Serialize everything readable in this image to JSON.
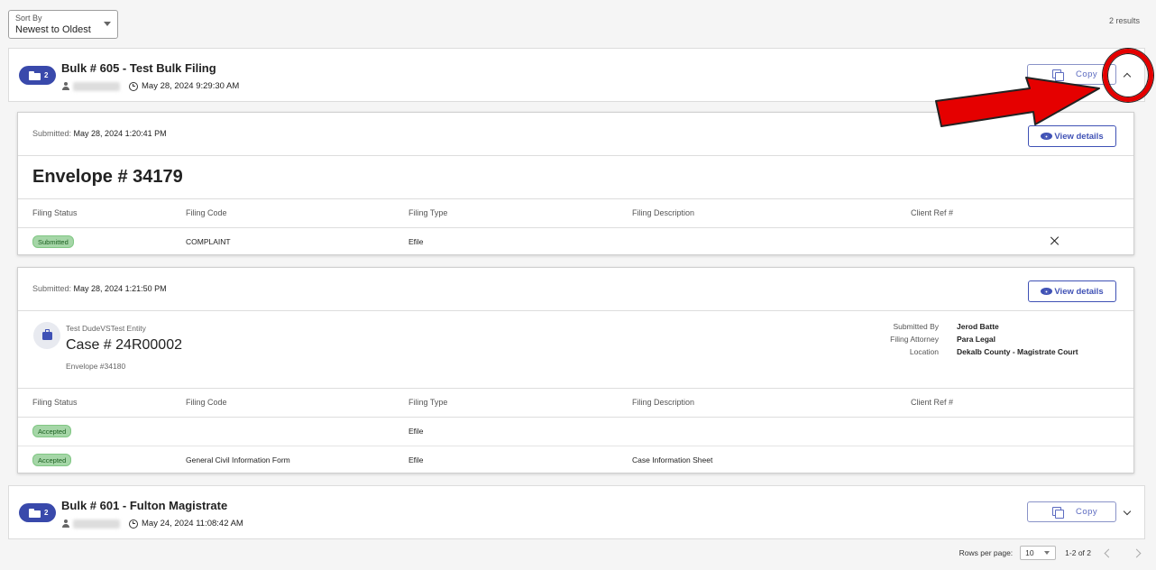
{
  "sort": {
    "label": "Sort By",
    "value": "Newest to Oldest"
  },
  "results_count": "2 results",
  "bulks": [
    {
      "folder_count": "2",
      "title": "Bulk # 605 - Test Bulk Filing",
      "datetime": "May 28, 2024 9:29:30 AM",
      "copy_label": "Copy",
      "expanded": true
    },
    {
      "folder_count": "2",
      "title": "Bulk # 601 - Fulton Magistrate",
      "datetime": "May 24, 2024 11:08:42 AM",
      "copy_label": "Copy",
      "expanded": false
    }
  ],
  "envelopes": [
    {
      "submitted_label": "Submitted:",
      "submitted_value": "May 28, 2024 1:20:41 PM",
      "view_details": "View details",
      "title": "Envelope # 34179",
      "columns": [
        "Filing Status",
        "Filing Code",
        "Filing Type",
        "Filing Description",
        "Client Ref #"
      ],
      "rows": [
        {
          "status": "Submitted",
          "code": "COMPLAINT",
          "type": "Efile",
          "description": "",
          "client_ref": ""
        }
      ]
    },
    {
      "submitted_label": "Submitted:",
      "submitted_value": "May 28, 2024 1:21:50 PM",
      "view_details": "View details",
      "case_parties": "Test DudeVSTest Entity",
      "case_number": "Case # 24R00002",
      "envelope_ref": "Envelope #34180",
      "info": [
        {
          "label": "Submitted By",
          "value": "Jerod Batte"
        },
        {
          "label": "Filing Attorney",
          "value": "Para Legal"
        },
        {
          "label": "Location",
          "value": "Dekalb County - Magistrate Court"
        }
      ],
      "columns": [
        "Filing Status",
        "Filing Code",
        "Filing Type",
        "Filing Description",
        "Client Ref #"
      ],
      "rows": [
        {
          "status": "Accepted",
          "code": "",
          "type": "Efile",
          "description": "",
          "client_ref": ""
        },
        {
          "status": "Accepted",
          "code": "General Civil Information Form",
          "type": "Efile",
          "description": "Case Information Sheet",
          "client_ref": ""
        }
      ]
    }
  ],
  "pagination": {
    "rows_per_page_label": "Rows per page:",
    "rows_per_page": "10",
    "range": "1-2 of 2"
  },
  "icons": {
    "sort_caret": "chevron-down-icon",
    "folder": "folder-icon",
    "person": "person-icon",
    "clock": "clock-icon",
    "copy": "copy-icon",
    "expand": "chevron-up-icon",
    "collapse": "chevron-down-icon",
    "eye": "eye-icon",
    "briefcase": "briefcase-icon",
    "remove": "close-icon"
  },
  "colors": {
    "primary": "#3f51b5",
    "badge_green": "#a5d6a7",
    "annotation_red": "#e50000"
  }
}
